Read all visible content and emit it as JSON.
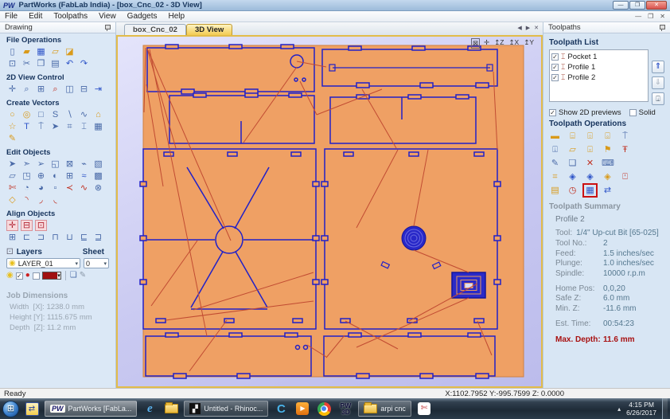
{
  "window": {
    "icon_text": "PW",
    "title": "PartWorks (FabLab India) - [box_Cnc_02 - 3D View]",
    "controls": {
      "minimize": "—",
      "maximize": "❐",
      "close": "✕"
    },
    "mdi_controls": {
      "minimize": "—",
      "restore": "❐",
      "close": "✕"
    }
  },
  "menubar": {
    "items": [
      {
        "name": "menu-file",
        "label": "File"
      },
      {
        "name": "menu-edit",
        "label": "Edit"
      },
      {
        "name": "menu-toolpaths",
        "label": "Toolpaths"
      },
      {
        "name": "menu-view",
        "label": "View"
      },
      {
        "name": "menu-gadgets",
        "label": "Gadgets"
      },
      {
        "name": "menu-help",
        "label": "Help"
      }
    ]
  },
  "left_panel": {
    "header": "Drawing",
    "file_ops": {
      "title": "File Operations",
      "row1": [
        {
          "name": "new-file-icon",
          "glyph": "▯"
        },
        {
          "name": "open-file-icon",
          "glyph": "▰",
          "cls": "y"
        },
        {
          "name": "save-file-icon",
          "glyph": "▦",
          "cls": "b"
        },
        {
          "name": "import-file-icon",
          "glyph": "▱",
          "cls": "y"
        },
        {
          "name": "export-file-icon",
          "glyph": "◪",
          "cls": "y"
        }
      ],
      "row2": [
        {
          "name": "select-all-icon",
          "glyph": "⊡"
        },
        {
          "name": "cut-icon",
          "glyph": "✂"
        },
        {
          "name": "copy-icon",
          "glyph": "❐"
        },
        {
          "name": "paste-icon",
          "glyph": "▤"
        },
        {
          "name": "undo-icon",
          "glyph": "↶",
          "cls": "b"
        },
        {
          "name": "redo-icon",
          "glyph": "↷",
          "cls": "b"
        }
      ]
    },
    "view_control": {
      "title": "2D View Control",
      "row1": [
        {
          "name": "pan-icon",
          "glyph": "✛"
        },
        {
          "name": "zoom-in-icon",
          "glyph": "⌕"
        },
        {
          "name": "zoom-box-icon",
          "glyph": "⊞"
        },
        {
          "name": "zoom-selected-icon",
          "glyph": "⌕",
          "cls": "r"
        },
        {
          "name": "zoom-extents-icon",
          "glyph": "◫"
        },
        {
          "name": "zoom-width-icon",
          "glyph": "⊟"
        },
        {
          "name": "switch-view-icon",
          "glyph": "⇥",
          "cls": "b"
        }
      ]
    },
    "create_vectors": {
      "title": "Create Vectors",
      "row1": [
        {
          "name": "circle-icon",
          "glyph": "○",
          "cls": "y"
        },
        {
          "name": "ellipse-icon",
          "glyph": "◎",
          "cls": "y"
        },
        {
          "name": "rectangle-icon",
          "glyph": "□"
        },
        {
          "name": "polyline-icon",
          "glyph": "S"
        },
        {
          "name": "line-icon",
          "glyph": "∖"
        },
        {
          "name": "curve-icon",
          "glyph": "∿"
        },
        {
          "name": "polygon-icon",
          "glyph": "⌂",
          "cls": "y"
        }
      ],
      "row2": [
        {
          "name": "star-icon",
          "glyph": "☆",
          "cls": "y"
        },
        {
          "name": "text-icon",
          "glyph": "T",
          "cls": "b"
        },
        {
          "name": "text-box-icon",
          "glyph": "⍑"
        },
        {
          "name": "select-text-icon",
          "glyph": "➤"
        },
        {
          "name": "transform-text-icon",
          "glyph": "⌗"
        },
        {
          "name": "dimension-icon",
          "glyph": "⌶"
        },
        {
          "name": "grid-icon",
          "glyph": "▦"
        }
      ],
      "row3": [
        {
          "name": "freehand-icon",
          "glyph": "✎",
          "cls": "y"
        }
      ]
    },
    "edit_objects": {
      "title": "Edit Objects",
      "row1": [
        {
          "name": "select-icon",
          "glyph": "➤"
        },
        {
          "name": "node-edit-icon",
          "glyph": "➣"
        },
        {
          "name": "transform-icon",
          "glyph": "➢"
        },
        {
          "name": "measure-icon",
          "glyph": "◱"
        },
        {
          "name": "delete-vector-icon",
          "glyph": "⊠"
        },
        {
          "name": "fillet-icon",
          "glyph": "⌁"
        },
        {
          "name": "distort-icon",
          "glyph": "▧"
        }
      ],
      "row2": [
        {
          "name": "move-icon",
          "glyph": "▱"
        },
        {
          "name": "scale-icon",
          "glyph": "◳"
        },
        {
          "name": "center-icon",
          "glyph": "⊕"
        },
        {
          "name": "mirror-icon",
          "glyph": "◐"
        },
        {
          "name": "array-copy-icon",
          "glyph": "⊞"
        },
        {
          "name": "curve-fit-icon",
          "glyph": "≈",
          "cls": "b"
        },
        {
          "name": "nesting-icon",
          "glyph": "▩"
        }
      ],
      "row3": [
        {
          "name": "trim-icon",
          "glyph": "✄",
          "cls": "r"
        },
        {
          "name": "weld-icon",
          "glyph": "◔"
        },
        {
          "name": "subtract-icon",
          "glyph": "◕"
        },
        {
          "name": "overlap-icon",
          "glyph": "▫"
        },
        {
          "name": "chamfer-icon",
          "glyph": "≺",
          "cls": "r"
        },
        {
          "name": "smooth-icon",
          "glyph": "∿",
          "cls": "r"
        },
        {
          "name": "explode-icon",
          "glyph": "⊗"
        }
      ],
      "row4": [
        {
          "name": "polygon-edit-icon",
          "glyph": "◇",
          "cls": "y"
        },
        {
          "name": "arc-icon",
          "glyph": "◝",
          "cls": "r"
        },
        {
          "name": "corner-icon",
          "glyph": "◞",
          "cls": "r"
        },
        {
          "name": "joint-icon",
          "glyph": "◟",
          "cls": "r"
        }
      ]
    },
    "align_objects": {
      "title": "Align Objects",
      "row1": [
        {
          "name": "center-align-icon",
          "glyph": "✛",
          "cls": "pk"
        },
        {
          "name": "h-center-align-icon",
          "glyph": "⊟",
          "cls": "pk"
        },
        {
          "name": "v-center-align-icon",
          "glyph": "⊡",
          "cls": "pk"
        }
      ],
      "row2": [
        {
          "name": "align-center-icon",
          "glyph": "⊞"
        },
        {
          "name": "align-left-icon",
          "glyph": "⊏"
        },
        {
          "name": "align-right-icon",
          "glyph": "⊐"
        },
        {
          "name": "align-top-icon",
          "glyph": "⊓"
        },
        {
          "name": "align-bottom-icon",
          "glyph": "⊔"
        },
        {
          "name": "space-h-icon",
          "glyph": "⊑"
        },
        {
          "name": "space-v-icon",
          "glyph": "⊒"
        }
      ]
    },
    "layers": {
      "cube_glyph": "⚀",
      "title": "Layers",
      "sheet_title": "Sheet",
      "layer_value": "LAYER_01",
      "sheet_value": "0",
      "dropdown_arrow": "▾",
      "bulb_glyph": "◉",
      "lock_glyph": "●",
      "visible_check": "✓",
      "lock_check": "",
      "copy_glyph": "❏",
      "merge_glyph": "✎"
    },
    "job_dimensions": {
      "title": "Job Dimensions",
      "rows": [
        {
          "text": "Width  [X]: 1238.0 mm"
        },
        {
          "text": "Height [Y]: 1115.675 mm"
        },
        {
          "text": "Depth  [Z]: 11.2 mm"
        }
      ]
    }
  },
  "tabs": {
    "items": [
      {
        "name": "tab-box-cnc-02",
        "label": "box_Cnc_02"
      },
      {
        "name": "tab-3d-view",
        "label": "3D View"
      }
    ],
    "nav": {
      "prev": "◀",
      "next": "▶",
      "close": "✕"
    }
  },
  "view_toolbar": [
    {
      "name": "iso-view-icon",
      "glyph": "⊠",
      "cls": "boxed"
    },
    {
      "name": "axes-3d-icon",
      "glyph": "✛"
    },
    {
      "name": "z-view-icon",
      "glyph": "↥Z"
    },
    {
      "name": "x-view-icon",
      "glyph": "↥X"
    },
    {
      "name": "y-view-icon",
      "glyph": "↥Y"
    }
  ],
  "right_panel": {
    "header": "Toolpaths",
    "list_title": "Toolpath List",
    "toolpaths": [
      {
        "name": "toolpath-pocket-1",
        "check": "✓",
        "icon": "⌶",
        "label": "Pocket 1"
      },
      {
        "name": "toolpath-profile-1",
        "check": "✓",
        "icon": "⌶",
        "label": "Profile 1"
      },
      {
        "name": "toolpath-profile-2",
        "check": "✓",
        "icon": "⌶",
        "label": "Profile 2"
      }
    ],
    "list_buttons": [
      {
        "name": "move-up-button",
        "glyph": "⇑",
        "cls": "up"
      },
      {
        "name": "move-down-button",
        "glyph": "⇓",
        "cls": "down"
      },
      {
        "name": "resize-list-button",
        "glyph": "⍗",
        "cls": "rs"
      }
    ],
    "show2d": {
      "check": "✓",
      "label": "Show 2D previews"
    },
    "solid": {
      "check": "",
      "label": "Solid"
    },
    "ops_title": "Toolpath Operations",
    "ops": {
      "row1": [
        {
          "name": "profile-toolpath-icon",
          "glyph": "▬",
          "cls": "y"
        },
        {
          "name": "pocket-toolpath-icon",
          "glyph": "⌸",
          "cls": "y"
        },
        {
          "name": "drill-toolpath-icon",
          "glyph": "⌹",
          "cls": "y"
        },
        {
          "name": "inlay-toolpath-icon",
          "glyph": "⌺",
          "cls": "y"
        },
        {
          "name": "vcarve-toolpath-icon",
          "glyph": "⍑"
        }
      ],
      "row2": [
        {
          "name": "prism-carve-icon",
          "glyph": "⍗"
        },
        {
          "name": "moulding-toolpath-icon",
          "glyph": "▱",
          "cls": "y"
        },
        {
          "name": "fluting-toolpath-icon",
          "glyph": "⌻",
          "cls": "y"
        },
        {
          "name": "drill-peck-icon",
          "glyph": "⚑",
          "cls": "y"
        },
        {
          "name": "texture-toolpath-icon",
          "glyph": "Ŧ",
          "cls": "r"
        }
      ],
      "row3": [
        {
          "name": "edit-toolpath-icon",
          "glyph": "✎"
        },
        {
          "name": "duplicate-toolpath-icon",
          "glyph": "❏"
        },
        {
          "name": "delete-toolpath-icon",
          "glyph": "✕",
          "cls": "r"
        },
        {
          "name": "recalculate-icon",
          "glyph": "⌨"
        }
      ],
      "row4": [
        {
          "name": "merge-toolpaths-icon",
          "glyph": "⌗",
          "cls": "y"
        },
        {
          "name": "preview-toolpath-icon",
          "glyph": "◈",
          "cls": "b"
        },
        {
          "name": "preview-all-icon",
          "glyph": "◈",
          "cls": "b"
        },
        {
          "name": "preview-selected-icon",
          "glyph": "◈",
          "cls": "y"
        },
        {
          "name": "delete-preview-icon",
          "glyph": "⍞",
          "cls": "r"
        }
      ],
      "row5": [
        {
          "name": "reset-preview-icon",
          "glyph": "▤",
          "cls": "y"
        },
        {
          "name": "estimate-time-icon",
          "glyph": "◷",
          "cls": "r"
        },
        {
          "name": "save-toolpath-icon",
          "glyph": "▦",
          "cls": "hl"
        },
        {
          "name": "transfer-toolpath-icon",
          "glyph": "⇄",
          "cls": "b"
        }
      ]
    },
    "summary": {
      "title": "Toolpath Summary",
      "name": "Profile 2",
      "tool_label": "Tool:",
      "tool_value": "1/4\" Up-cut Bit [65-025]",
      "rows": [
        {
          "label": "Tool No.:",
          "value": "2"
        },
        {
          "label": "Feed:",
          "value": "1.5 inches/sec"
        },
        {
          "label": "Plunge:",
          "value": "1.0 inches/sec"
        },
        {
          "label": "Spindle:",
          "value": "10000 r.p.m"
        },
        {
          "label": "Home Pos:",
          "value": "0,0,20",
          "cls": "gap"
        },
        {
          "label": "Safe Z:",
          "value": "6.0 mm"
        },
        {
          "label": "Min. Z:",
          "value": "-11.6 mm"
        },
        {
          "label": "Est. Time:",
          "value": "00:54:23",
          "cls": "gap"
        },
        {
          "label": "Max. Depth:",
          "value": "11.6 mm",
          "cls": "max"
        }
      ]
    }
  },
  "status": {
    "ready": "Ready",
    "coords": "X:1102.7952 Y:-995.7599 Z:  0.0000"
  },
  "taskbar": {
    "start_glyph": "⊞",
    "partworks_logo": "PW",
    "partworks_label": "PartWorks [FabLa...",
    "ie_glyph": "e",
    "rhino_glyph": "▞",
    "rhino_label": "Untitled - Rhinoc...",
    "c_glyph": "C",
    "play_glyph": "▶",
    "pw3d_line1": "PW",
    "pw3d_line2": "3D",
    "arpi_label": "arpi cnc",
    "snip_glyph": "✄",
    "tray_arrow": "▴",
    "time": "4:15 PM",
    "date": "6/26/2017"
  },
  "colors": {
    "board": "#efa064",
    "vector_blue": "#2020c8",
    "rapid_red": "#c14b32",
    "canvas_bg": "#c9c9f1",
    "canvas_border": "#e2bc4a",
    "highlight_red": "#cc1111",
    "max_depth_red": "#a81010",
    "active_tab": "#f3cb52"
  }
}
